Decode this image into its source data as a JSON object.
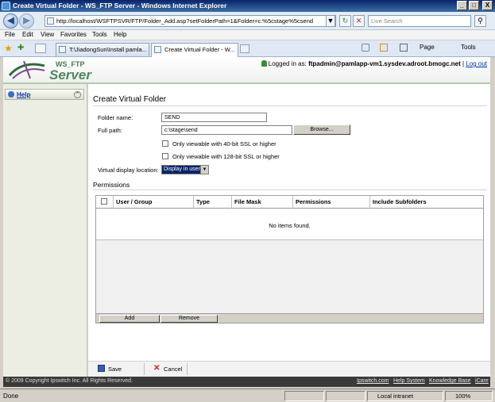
{
  "window": {
    "title": "Create Virtual Folder - WS_FTP Server - Windows Internet Explorer",
    "minimize": "_",
    "maximize": "□",
    "close": "X"
  },
  "browser": {
    "address": "http://localhost/WSFTPSVR/FTP/Folder_Add.asp?setFolderPath=1&Folder=c:%5cstage%5csend",
    "search_placeholder": "Live Search",
    "back": "◀",
    "forward": "▶",
    "dropdown": "▼",
    "refresh": "↻",
    "stop": "✕",
    "search_go": "⚲",
    "menu": [
      "File",
      "Edit",
      "View",
      "Favorites",
      "Tools",
      "Help"
    ],
    "tabs": [
      {
        "label": "T:\\JiadongSun\\Install pamla..."
      },
      {
        "label": "Create Virtual Folder - W..."
      }
    ],
    "toolbar_right": {
      "page": "Page",
      "tools": "Tools"
    },
    "favorites_star": "★",
    "add_favorite": "✚",
    "status": "Done",
    "zone": "Local intranet",
    "zoom": "100%"
  },
  "app": {
    "logo_top": "WS_FTP",
    "logo_bottom": "Server",
    "logged_in_label": "Logged in as:",
    "logged_in_user": "ftpadmin@pamlapp-vm1.sysdev.adroot.bmogc.net",
    "logout": "Log out",
    "help": "Help",
    "collapse": "^"
  },
  "form": {
    "title": "Create Virtual Folder",
    "folder_name_label": "Folder name:",
    "folder_name_value": "SEND",
    "full_path_label": "Full path:",
    "full_path_value": "c:\\stage\\send",
    "browse": "Browse...",
    "ssl40": "Only viewable with 40-bit SSL or higher",
    "ssl128": "Only viewable with 128-bit SSL or higher",
    "display_location_label": "Virtual display location:",
    "display_location_value": "Display in user",
    "permissions_title": "Permissions",
    "columns": [
      "User / Group",
      "Type",
      "File Mask",
      "Permissions",
      "Include Subfolders"
    ],
    "empty_message": "No items found.",
    "add": "Add",
    "remove": "Remove",
    "save": "Save",
    "cancel": "Cancel"
  },
  "footer": {
    "copyright": "© 2009 Copyright Ipswitch Inc. All Rights Reserved.",
    "links": [
      "Ipswitch.com",
      "Help System",
      "Knowledge Base",
      "iCare"
    ]
  }
}
